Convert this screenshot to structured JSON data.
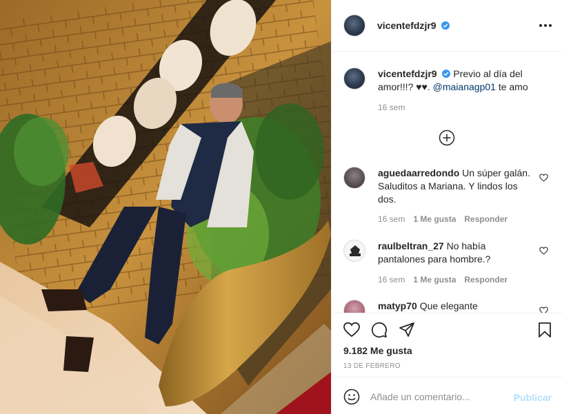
{
  "post": {
    "username": "vicentefdzjr9",
    "verified_icon": "verified-badge-icon",
    "more_icon": "more-options-icon"
  },
  "caption": {
    "username": "vicentefdzjr9",
    "text": "Previo al día del amor!!!? ♥♥.",
    "mention": "@maianagp01",
    "text_after": "te amo",
    "time": "16 sem"
  },
  "load_more_icon": "plus-circle-icon",
  "comments": [
    {
      "username": "aguedaarredondo",
      "text": "Un súper galán. Saluditos a Mariana. Y lindos los dos. ",
      "time": "16 sem",
      "likes": "1 Me gusta",
      "reply": "Responder"
    },
    {
      "username": "raulbeltran_27",
      "text": "No había pantalones para hombre.?",
      "time": "16 sem",
      "likes": "1 Me gusta",
      "reply": "Responder"
    },
    {
      "username": "matyp70",
      "text": "Que elegante"
    }
  ],
  "actions": {
    "like_icon": "heart-icon",
    "comment_icon": "comment-icon",
    "share_icon": "share-icon",
    "save_icon": "bookmark-icon",
    "likes_count": "9.182 Me gusta",
    "date": "13 DE FEBRERO"
  },
  "add_comment": {
    "emoji_icon": "emoji-icon",
    "placeholder": "Añade un comentario...",
    "publish_label": "Publicar"
  }
}
